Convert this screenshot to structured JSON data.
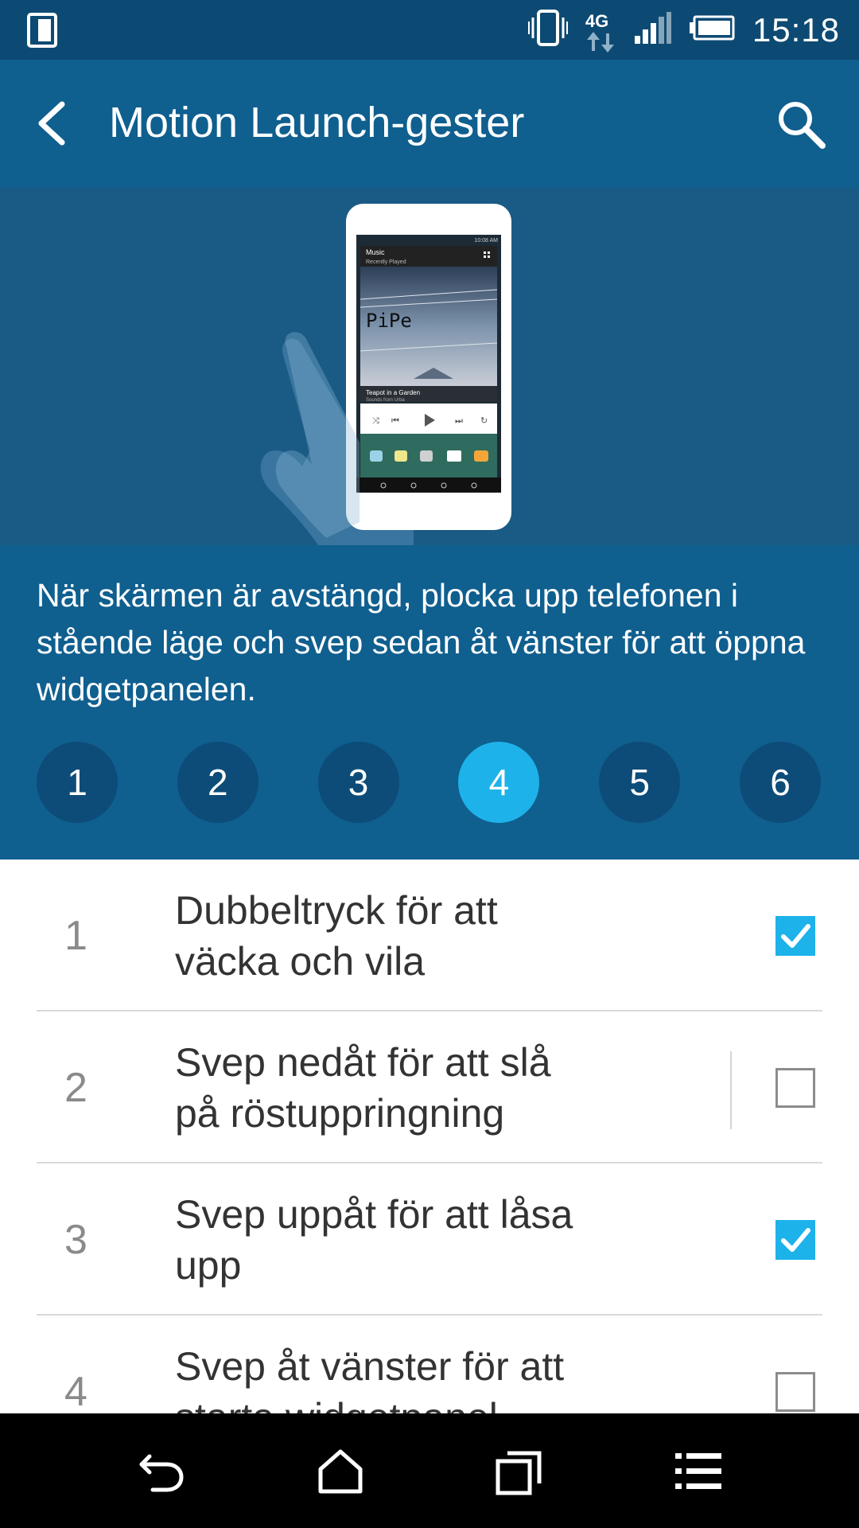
{
  "status_bar": {
    "time": "15:18",
    "network_type": "4G",
    "icons": [
      "dual-screen-icon",
      "vibrate-icon",
      "network-4g-icon",
      "signal-icon",
      "battery-icon"
    ]
  },
  "app_bar": {
    "title": "Motion Launch-gester"
  },
  "hero": {
    "music_widget": {
      "title": "Music",
      "subtitle": "Recently Played",
      "album_text": "PiPe",
      "track": "Teapot in a Garden",
      "artist": "Sounds from Urba",
      "phone_time": "10:08 AM"
    }
  },
  "description": "När skärmen är avstängd, plocka upp telefonen i stående läge och svep sedan åt vänster för att öppna widgetpanelen.",
  "steps": {
    "items": [
      "1",
      "2",
      "3",
      "4",
      "5",
      "6"
    ],
    "active_index": 3
  },
  "gestures": [
    {
      "number": "1",
      "label": "Dubbeltryck för att väcka och vila",
      "checked": true
    },
    {
      "number": "2",
      "label": "Svep nedåt för att slå på röstuppringning",
      "checked": false
    },
    {
      "number": "3",
      "label": "Svep uppåt för att låsa upp",
      "checked": true
    },
    {
      "number": "4",
      "label": "Svep åt vänster för att starta widgetpanel",
      "checked": false
    }
  ],
  "colors": {
    "status_bar": "#0d4a73",
    "app_bar": "#0f5f8f",
    "hero": "#1a5b86",
    "accent": "#1eb2ea",
    "step_inactive": "#0d4c78"
  },
  "nav_bar": {
    "icons": [
      "back-icon",
      "home-icon",
      "recents-icon",
      "menu-icon"
    ]
  }
}
